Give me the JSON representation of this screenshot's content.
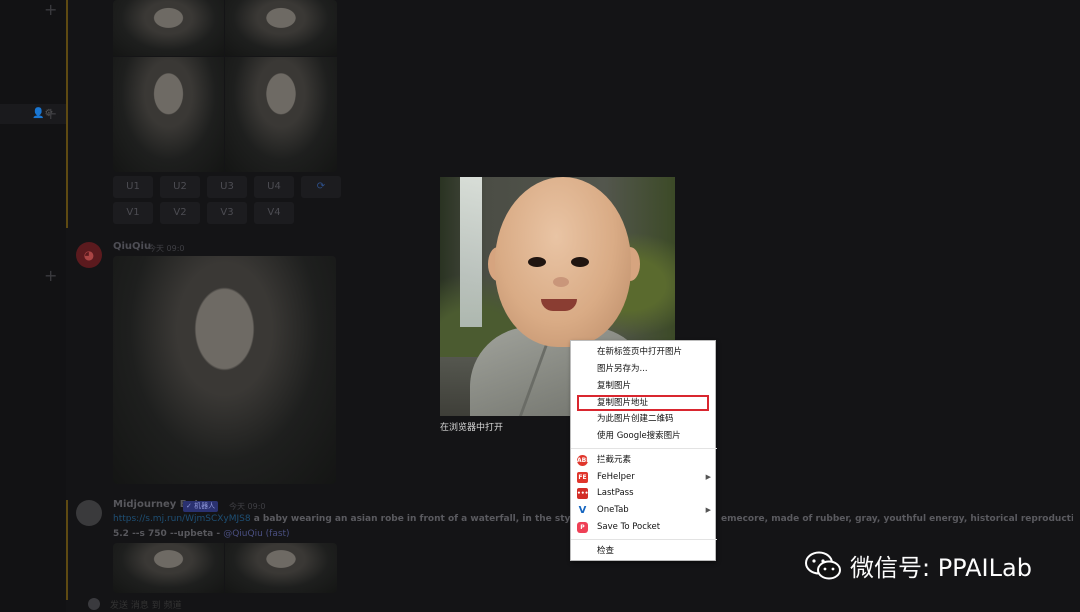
{
  "background": {
    "upscale_buttons": [
      "U1",
      "U2",
      "U3",
      "U4"
    ],
    "variation_buttons": [
      "V1",
      "V2",
      "V3",
      "V4"
    ],
    "user_message": {
      "username": "QiuQiu",
      "meta": "今天 09:0"
    },
    "bot_message": {
      "username": "Midjourney Bot",
      "badge": "✓ 机器人",
      "meta": "今天 09:0",
      "link": "https://s.mj.run/WjmSCXyMJS8",
      "prompt": " a baby wearing an asian robe in front of a waterfall, in the style of a",
      "prompt_tail": "emecore, made of rubber, gray, youthful energy, historical reproductions, yello",
      "params": "5.2 --s 750 --upbeta - ",
      "mention": "@QiuQiu (fast)"
    },
    "chat_placeholder": "发送 消息 到 频道"
  },
  "preview": {
    "open_in_browser_label": "在浏览器中打开"
  },
  "context_menu": {
    "items": [
      {
        "label": "在新标签页中打开图片"
      },
      {
        "label": "图片另存为..."
      },
      {
        "label": "复制图片"
      },
      {
        "label": "复制图片地址",
        "highlighted": true
      },
      {
        "label": "为此图片创建二维码"
      },
      {
        "label": "使用 Google搜索图片"
      }
    ],
    "extensions": [
      {
        "label": "拦截元素",
        "icon": "adblock-icon",
        "icon_text": "ABP",
        "color": "#e0352b"
      },
      {
        "label": "FeHelper",
        "icon": "fehelper-icon",
        "icon_text": "FE",
        "color": "#e0352b",
        "submenu": true
      },
      {
        "label": "LastPass",
        "icon": "lastpass-icon",
        "icon_text": "•••",
        "color": "#d32d27"
      },
      {
        "label": "OneTab",
        "icon": "onetab-icon",
        "icon_text": "V",
        "color": "#1565c0",
        "submenu": true
      },
      {
        "label": "Save To Pocket",
        "icon": "pocket-icon",
        "icon_text": "P",
        "color": "#ef4056"
      }
    ],
    "inspect_label": "检查"
  },
  "watermark": {
    "text": "微信号: PPAILab"
  }
}
